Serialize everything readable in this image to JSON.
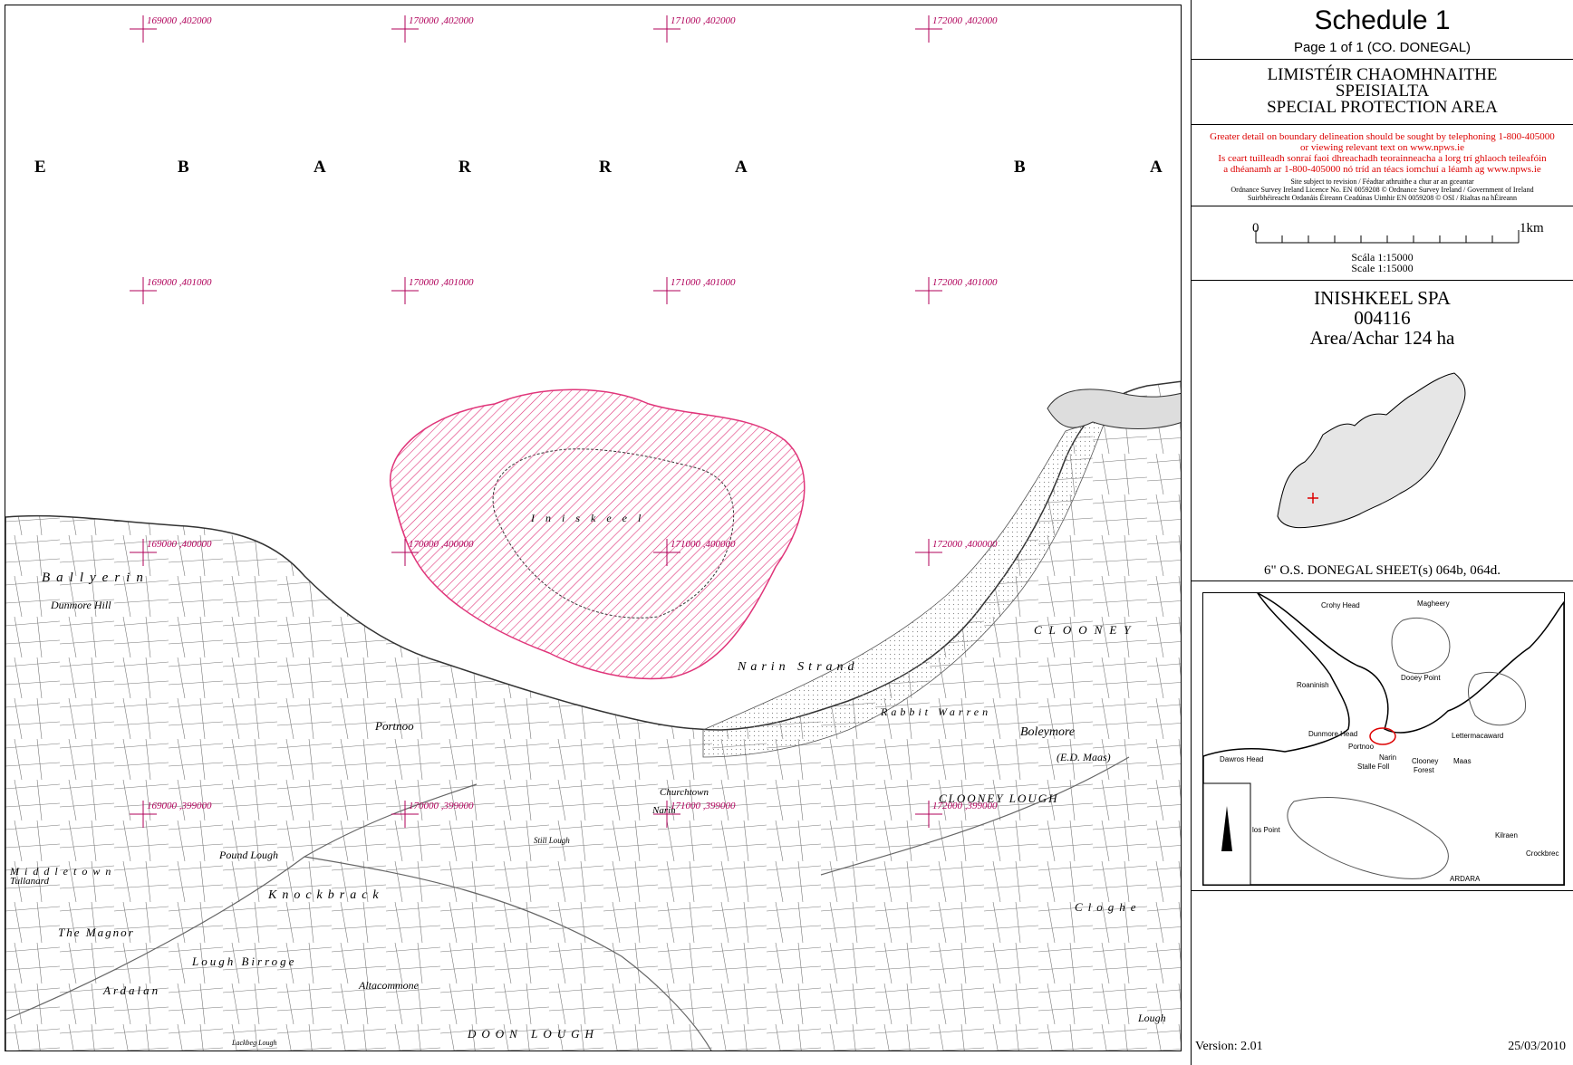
{
  "header": {
    "title": "Schedule 1",
    "subtitle": "Page 1 of 1 (CO. DONEGAL)"
  },
  "designation": {
    "line1": "LIMISTÉIR CHAOMHNAITHE",
    "line2": "SPEISIALTA",
    "line3": "SPECIAL PROTECTION AREA"
  },
  "notice": {
    "line1": "Greater detail on boundary delineation should be sought by telephoning 1-800-405000",
    "line2": "or viewing relevant text on www.npws.ie",
    "line3": "Is ceart tuilleadh sonraí faoi dhreachadh teorainneacha a lorg trí ghlaoch teileafóin",
    "line4": "a dhéanamh ar 1-800-405000 nó tríd an téacs iomchuí a léamh ag www.npws.ie",
    "fine1": "Site subject to revision / Féadtar athruithe a chur ar an gceantar",
    "fine2": "Ordnance Survey Ireland Licence No. EN 0059208 © Ordnance Survey Ireland / Government of Ireland",
    "fine3": "Suirbhéireacht Ordanáis Éireann Ceadúnas Uimhir EN 0059208 © OSI / Rialtas na hÉireann"
  },
  "scale": {
    "start": "0",
    "end": "1km",
    "irish": "Scála 1:15000",
    "english": "Scale 1:15000"
  },
  "site": {
    "name": "INISHKEEL SPA",
    "code": "004116",
    "area": "Area/Achar 124 ha"
  },
  "sheet_ref": "6\" O.S.  DONEGAL  SHEET(s) 064b, 064d.",
  "locator_labels": [
    "Crohy Head",
    "Magheery",
    "Roaninish",
    "Dooey Point",
    "Dunmore Head",
    "Portnoo",
    "Lettermacaward",
    "Dawros Head",
    "Narin",
    "Clooney",
    "Forest",
    "Maas",
    "Stalle Foll",
    "Kilraen",
    "Crockbrec",
    "ARDARA",
    "los Point"
  ],
  "map": {
    "grid_labels": [
      "169000 ,402000",
      "170000 ,402000",
      "171000 ,402000",
      "172000 ,402000",
      "169000 ,401000",
      "170000 ,401000",
      "171000 ,401000",
      "172000 ,401000",
      "169000 ,400000",
      "170000 ,400000",
      "171000 ,400000",
      "172000 ,400000",
      "169000 ,399000",
      "170000 ,399000",
      "171000 ,399000",
      "172000 ,399000"
    ],
    "sea_letters": [
      "E",
      "B",
      "A",
      "R",
      "R",
      "A",
      "B",
      "A"
    ],
    "place_labels": [
      "Ballyerin",
      "Dunmore Hill",
      "Portnoo",
      "Narin Strand",
      "Rabbit Warren",
      "CLOONEY",
      "Boleymore",
      "(E.D. Maas)",
      "CLOONEY LOUGH",
      "Pound Lough",
      "Knockbrack",
      "The Magnor",
      "Lough Birroge",
      "Ardalan",
      "Altacommone",
      "Churchtown",
      "Narin",
      "Lough",
      "DOON LOUGH",
      "Iniskeel",
      "Lackbeg Lough",
      "Still Lough",
      "Ardalan",
      "Middletown",
      "Tullanard",
      "Cloghe"
    ]
  },
  "footer": {
    "version": "Version: 2.01",
    "date": "25/03/2010"
  },
  "colors": {
    "grid": "#b0005a",
    "spa_boundary": "#e0357a",
    "notice_text": "#dd0000",
    "locator_land": "#e6e6e6"
  }
}
